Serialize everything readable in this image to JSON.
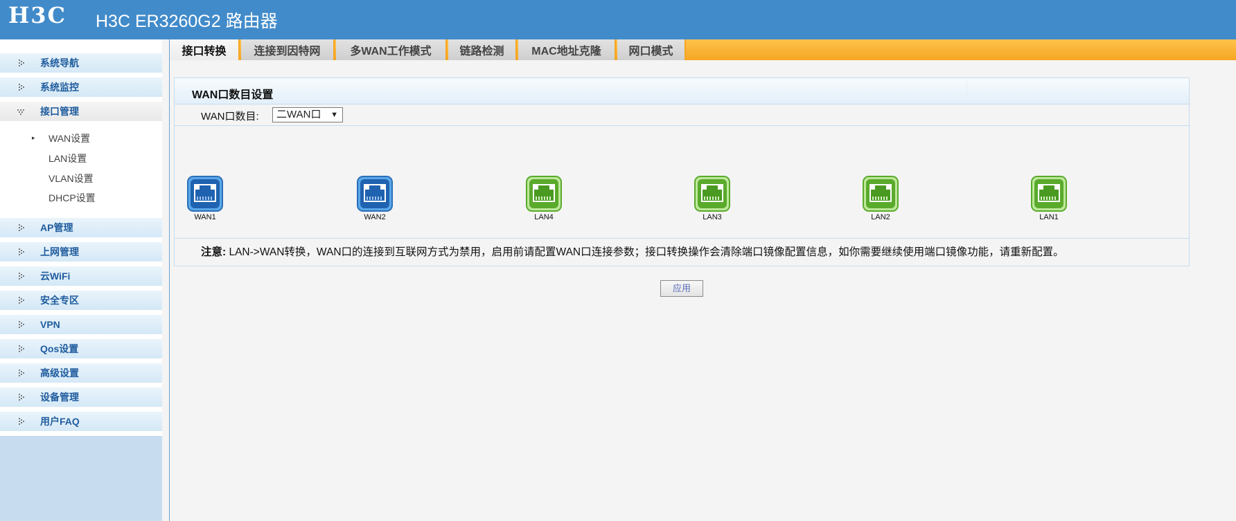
{
  "header": {
    "logo_text": "H3C",
    "title": "H3C ER3260G2 路由器",
    "background": "#428bca"
  },
  "sidebar": {
    "items": [
      {
        "label": "系统导航"
      },
      {
        "label": "系统监控"
      },
      {
        "label": "接口管理",
        "expanded": true
      },
      {
        "label": "AP管理"
      },
      {
        "label": "上网管理"
      },
      {
        "label": "云WiFi"
      },
      {
        "label": "安全专区"
      },
      {
        "label": "VPN"
      },
      {
        "label": "Qos设置"
      },
      {
        "label": "高级设置"
      },
      {
        "label": "设备管理"
      },
      {
        "label": "用户FAQ"
      }
    ],
    "sub_items": [
      {
        "label": "WAN设置",
        "selected": true
      },
      {
        "label": "LAN设置"
      },
      {
        "label": "VLAN设置"
      },
      {
        "label": "DHCP设置"
      }
    ]
  },
  "tabs": [
    {
      "label": "接口转换",
      "active": true
    },
    {
      "label": "连接到因特网"
    },
    {
      "label": "多WAN工作模式"
    },
    {
      "label": "链路检测"
    },
    {
      "label": "MAC地址克隆"
    },
    {
      "label": "网口模式"
    }
  ],
  "panel": {
    "title": "WAN口数目设置",
    "wan_count_label": "WAN口数目:",
    "wan_count_value": "二WAN口",
    "ports": [
      {
        "label": "WAN1",
        "type": "wan"
      },
      {
        "label": "WAN2",
        "type": "wan"
      },
      {
        "label": "LAN4",
        "type": "lan"
      },
      {
        "label": "LAN3",
        "type": "lan"
      },
      {
        "label": "LAN2",
        "type": "lan"
      },
      {
        "label": "LAN1",
        "type": "lan"
      }
    ],
    "note_prefix": "注意:",
    "note_text": " LAN->WAN转换，WAN口的连接到互联网方式为禁用，启用前请配置WAN口连接参数；接口转换操作会清除端口镜像配置信息，如你需要继续使用端口镜像功能，请重新配置。"
  },
  "apply_label": "应用",
  "colors": {
    "tab_bar": "#f6a623",
    "wan_port": "#1f62b0",
    "lan_port": "#5aaa2c",
    "menu_text": "#1f5c9e"
  }
}
